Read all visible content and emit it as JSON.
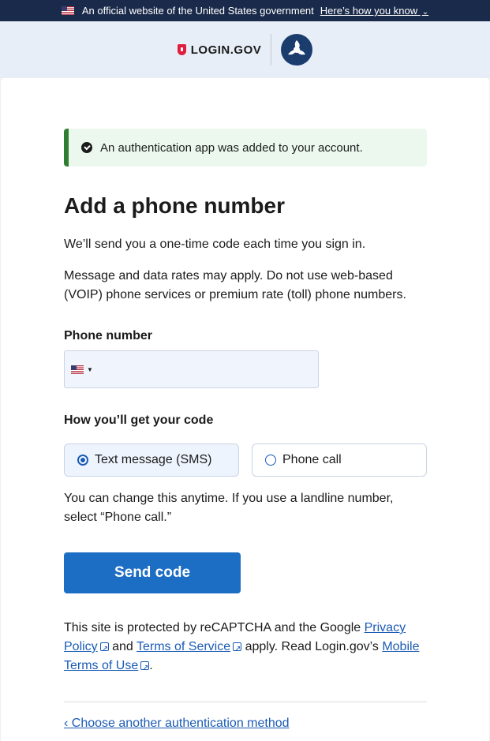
{
  "banner": {
    "text": "An official website of the United States government",
    "how_link": "Here’s how you know"
  },
  "header": {
    "logo_text": "LOGIN.GOV"
  },
  "alert": {
    "text": "An authentication app was added to your account."
  },
  "page": {
    "title": "Add a phone number",
    "intro": "We’ll send you a one-time code each time you sign in.",
    "rates_note": "Message and data rates may apply. Do not use web-based (VOIP) phone services or premium rate (toll) phone numbers."
  },
  "phone": {
    "label": "Phone number",
    "value": "",
    "country_icon": "us-flag-icon"
  },
  "method": {
    "label": "How you’ll get your code",
    "options": [
      {
        "label": "Text message (SMS)",
        "selected": true
      },
      {
        "label": "Phone call",
        "selected": false
      }
    ],
    "note": "You can change this anytime. If you use a landline number, select “Phone call.”"
  },
  "actions": {
    "send_label": "Send code"
  },
  "recaptcha": {
    "pre": "This site is protected by reCAPTCHA and the Google ",
    "privacy_link": "Privacy Policy",
    "mid": " and ",
    "terms_link": "Terms of Service",
    "post": " apply. Read Login.gov’s ",
    "mobile_link": "Mobile Terms of Use",
    "end": "."
  },
  "footer": {
    "back_link": "‹ Choose another authentication method"
  },
  "colors": {
    "primary": "#1c6dc4",
    "success": "#2e7d32",
    "banner_bg": "#1a2a4a"
  }
}
